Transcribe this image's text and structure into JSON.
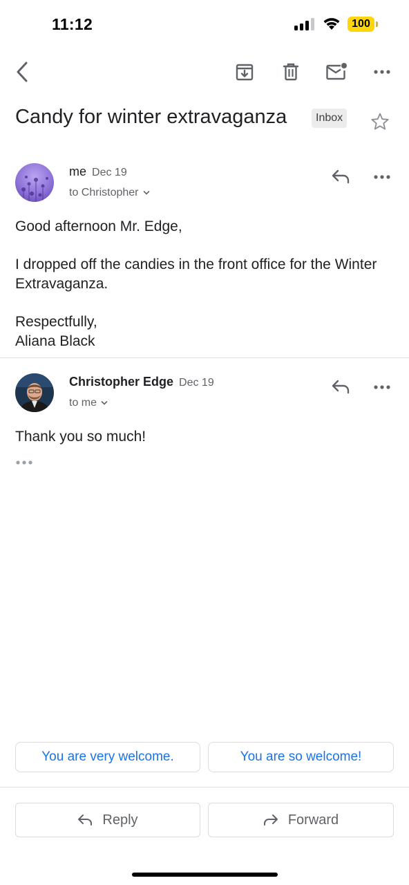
{
  "status_bar": {
    "time": "11:12",
    "battery_level": "100",
    "signal_bars": 3,
    "signal_bars_total": 4,
    "battery_color": "#ffd60a"
  },
  "toolbar": {
    "back_icon": "chevron-left-icon",
    "archive_icon": "archive-icon",
    "delete_icon": "trash-icon",
    "mark_unread_icon": "mail-unread-icon",
    "more_icon": "more-horizontal-icon"
  },
  "thread": {
    "subject": "Candy for winter extravaganza",
    "label": "Inbox",
    "starred": false
  },
  "messages": [
    {
      "sender": "me",
      "date": "Dec 19",
      "recipient": "to Christopher",
      "body": [
        "Good afternoon Mr. Edge,",
        "",
        "I dropped off the candies in the front office for the Winter Extravaganza.",
        "",
        "Respectfully,",
        "Aliana Black"
      ],
      "avatar_color": "#8a6fd6"
    },
    {
      "sender": "Christopher Edge",
      "date": "Dec 19",
      "recipient": "to me",
      "body": [
        "Thank you so much!"
      ],
      "avatar_color": "#1e3550"
    }
  ],
  "smart_replies": [
    "You are very welcome.",
    "You are so welcome!"
  ],
  "actions": {
    "reply_label": "Reply",
    "forward_label": "Forward"
  },
  "colors": {
    "link_blue": "#1a73e8",
    "icon_gray": "#5f6368",
    "text": "#202124"
  }
}
